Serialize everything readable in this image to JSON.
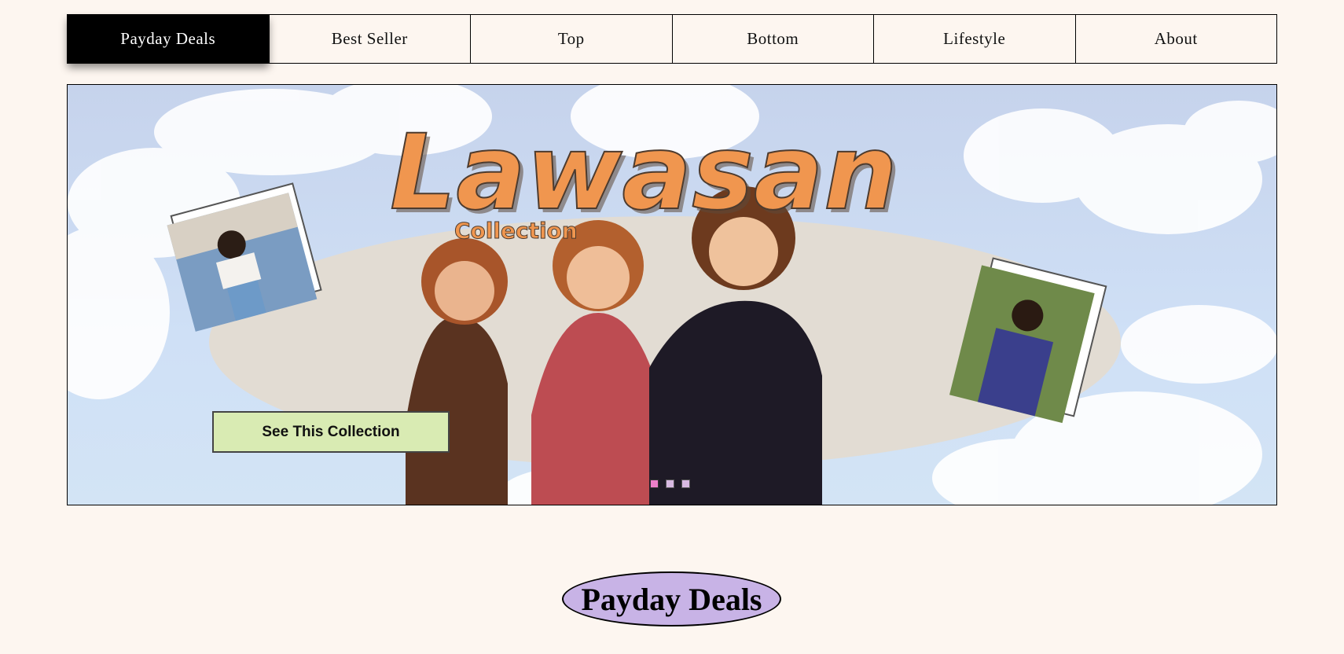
{
  "nav": {
    "items": [
      "Payday Deals",
      "Best Seller",
      "Top",
      "Bottom",
      "Lifestyle",
      "About"
    ],
    "active_index": 0
  },
  "banner": {
    "logo_text": "Lawasan",
    "logo_subtext": "Collection",
    "cta_label": "See This Collection",
    "slide_count": 3,
    "active_slide": 1
  },
  "section": {
    "title": "Payday Deals"
  },
  "colors": {
    "background": "#fdf6f0",
    "nav_active_bg": "#000000",
    "logo_orange": "#f0964f",
    "cta_green": "#d9ebb3",
    "title_purple": "#c8b3e6",
    "dot_active": "#ec7fc9",
    "dot_inactive": "#d8b9e2"
  }
}
